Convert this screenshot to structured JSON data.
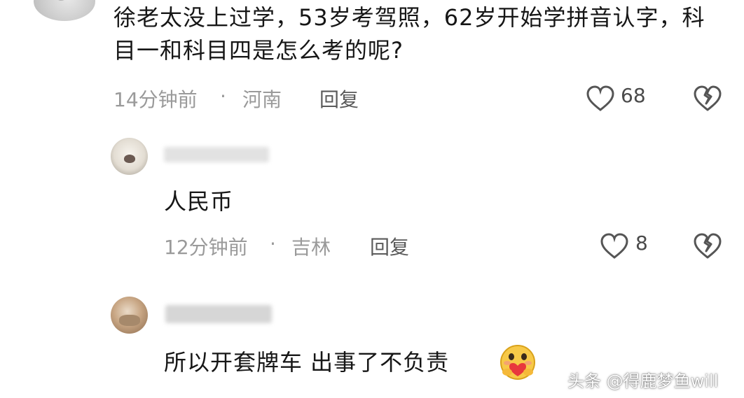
{
  "comments": [
    {
      "text": "徐老太没上过学，53岁考驾照，62岁开始学拼音认字，科目一和科目四是怎么考的呢?",
      "time": "14分钟前",
      "separator": "·",
      "location": "河南",
      "reply_label": "回复",
      "likes": "68"
    },
    {
      "text": "人民币",
      "time": "12分钟前",
      "separator": "·",
      "location": "吉林",
      "reply_label": "回复",
      "likes": "8"
    },
    {
      "text": "所以开套牌车 出事了不负责"
    }
  ],
  "watermark": "头条 @得鹿梦鱼will",
  "icons": {
    "like": "heart-outline-icon",
    "dislike": "broken-heart-icon",
    "emoji": "hugging-heart-emoji"
  }
}
